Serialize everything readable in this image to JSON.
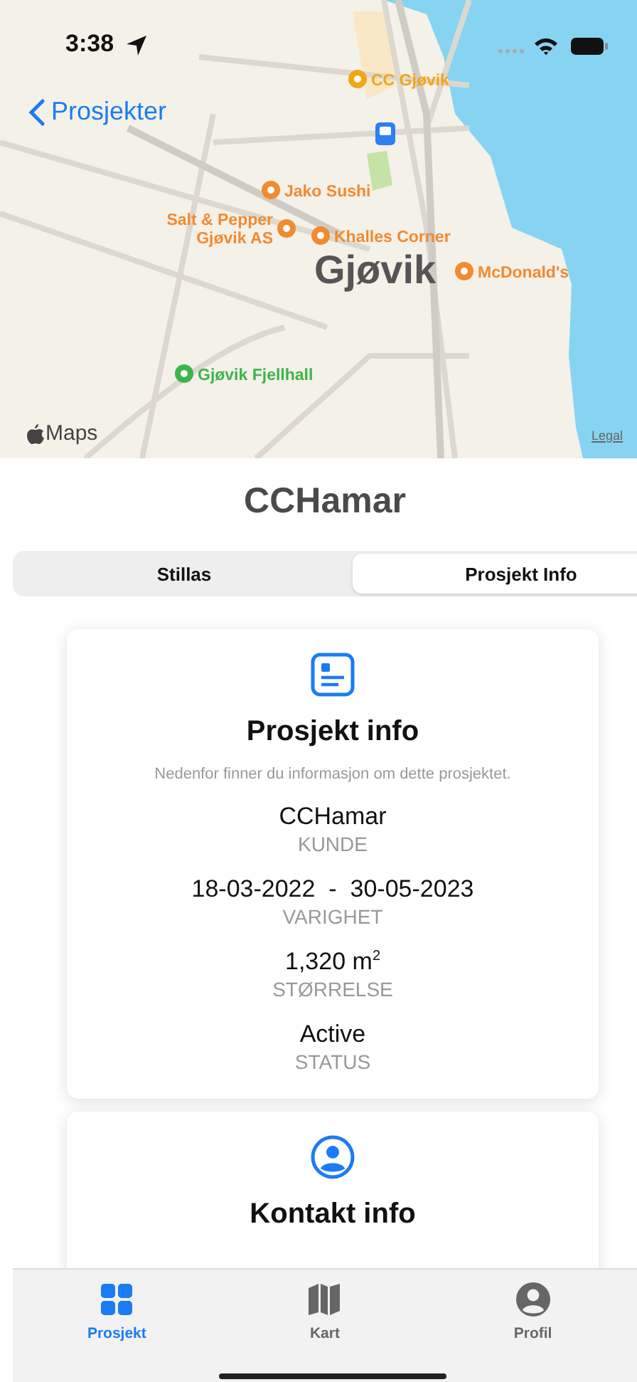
{
  "status_bar": {
    "time": "3:38"
  },
  "map": {
    "back_label": "Prosjekter",
    "city": "Gjøvik",
    "logo": "Maps",
    "legal": "Legal",
    "pois": [
      {
        "name": "CC Gjøvik",
        "color": "#f2a516"
      },
      {
        "name": "Jako Sushi",
        "color": "#f28a30"
      },
      {
        "name": "Salt & Pepper Gjøvik AS",
        "color": "#f28a30"
      },
      {
        "name": "Khalles Corner",
        "color": "#f28a30"
      },
      {
        "name": "McDonald's",
        "color": "#f28a30"
      },
      {
        "name": "Gjøvik Fjellhall",
        "color": "#3cb54a"
      }
    ]
  },
  "title": "CCHamar",
  "segments": [
    {
      "label": "Stillas",
      "selected": false
    },
    {
      "label": "Prosjekt Info",
      "selected": true
    }
  ],
  "cards": [
    {
      "kind": "info",
      "title": "Prosjekt info",
      "subtitle": "Nedenfor finner du informasjon om dette prosjektet.",
      "fields": [
        {
          "value": "CCHamar",
          "label": "KUNDE"
        },
        {
          "value": "18-03-2022  -  30-05-2023",
          "label": "VARIGHET"
        },
        {
          "value": "1,320 m$^{2}$",
          "label": "STØRRELSE"
        },
        {
          "value": "Active",
          "label": "STATUS"
        }
      ]
    },
    {
      "kind": "contact",
      "title": "Kontakt info"
    }
  ],
  "tab_bar": [
    {
      "label": "Prosjekt",
      "selected": true
    },
    {
      "label": "Kart",
      "selected": false
    },
    {
      "label": "Profil",
      "selected": false
    }
  ]
}
